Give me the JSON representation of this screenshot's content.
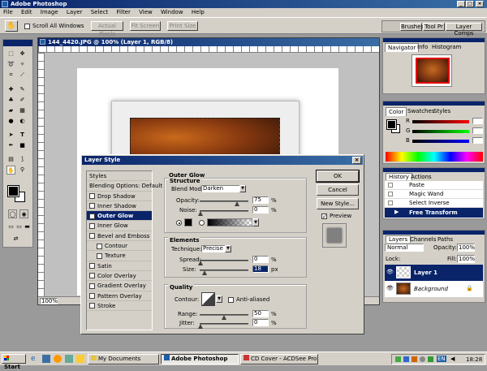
{
  "app": {
    "title": "Adobe Photoshop"
  },
  "menu": [
    "File",
    "Edit",
    "Image",
    "Layer",
    "Select",
    "Filter",
    "View",
    "Window",
    "Help"
  ],
  "options_bar": {
    "scroll_all": "Scroll All Windows",
    "actual_pixels": "Actual Pixels",
    "fit_screen": "Fit Screen",
    "print_size": "Print Size"
  },
  "well_tabs": [
    "Brushes",
    "Tool Pr",
    "Layer Comps"
  ],
  "document": {
    "title": "144_4420.JPG @ 100% (Layer 1, RGB/8)",
    "zoom": "100%"
  },
  "navigator": {
    "tabs": [
      "Navigator",
      "Info",
      "Histogram"
    ]
  },
  "color_panel": {
    "tabs": [
      "Color",
      "Swatches",
      "Styles"
    ],
    "channels": [
      "R",
      "G",
      "B"
    ]
  },
  "history": {
    "tabs": [
      "History",
      "Actions"
    ],
    "items": [
      "Paste",
      "Magic Wand",
      "Select Inverse",
      "Free Transform"
    ]
  },
  "layers": {
    "tabs": [
      "Layers",
      "Channels",
      "Paths"
    ],
    "blend_mode": "Normal",
    "opacity_label": "Opacity:",
    "opacity": "100%",
    "lock_label": "Lock:",
    "fill_label": "Fill:",
    "fill": "100%",
    "items": [
      {
        "name": "Layer 1"
      },
      {
        "name": "Background"
      }
    ]
  },
  "dialog": {
    "title": "Layer Style",
    "styles_header": "Styles",
    "blending_options": "Blending Options: Default",
    "effects": [
      {
        "label": "Drop Shadow",
        "checked": false,
        "indent": false
      },
      {
        "label": "Inner Shadow",
        "checked": false,
        "indent": false
      },
      {
        "label": "Outer Glow",
        "checked": true,
        "indent": false
      },
      {
        "label": "Inner Glow",
        "checked": false,
        "indent": false
      },
      {
        "label": "Bevel and Emboss",
        "checked": false,
        "indent": false
      },
      {
        "label": "Contour",
        "checked": false,
        "indent": true
      },
      {
        "label": "Texture",
        "checked": false,
        "indent": true
      },
      {
        "label": "Satin",
        "checked": false,
        "indent": false
      },
      {
        "label": "Color Overlay",
        "checked": false,
        "indent": false
      },
      {
        "label": "Gradient Overlay",
        "checked": false,
        "indent": false
      },
      {
        "label": "Pattern Overlay",
        "checked": false,
        "indent": false
      },
      {
        "label": "Stroke",
        "checked": false,
        "indent": false
      }
    ],
    "section_title": "Outer Glow",
    "structure": {
      "title": "Structure",
      "blend_mode_label": "Blend Mode:",
      "blend_mode": "Darken",
      "opacity_label": "Opacity:",
      "opacity": "75",
      "opacity_unit": "%",
      "noise_label": "Noise:",
      "noise": "0",
      "noise_unit": "%"
    },
    "elements": {
      "title": "Elements",
      "technique_label": "Technique:",
      "technique": "Precise",
      "spread_label": "Spread:",
      "spread": "0",
      "spread_unit": "%",
      "size_label": "Size:",
      "size": "18",
      "size_unit": "px"
    },
    "quality": {
      "title": "Quality",
      "contour_label": "Contour:",
      "anti_aliased": "Anti-aliased",
      "range_label": "Range:",
      "range": "50",
      "range_unit": "%",
      "jitter_label": "Jitter:",
      "jitter": "0",
      "jitter_unit": "%"
    },
    "buttons": {
      "ok": "OK",
      "cancel": "Cancel",
      "new_style": "New Style...",
      "preview": "Preview"
    }
  },
  "taskbar": {
    "start": "Start",
    "tasks": [
      "My Documents",
      "Adobe Photoshop",
      "CD Cover - ACDSee Pro P..."
    ],
    "tray_lang": "EN",
    "clock": "18:28"
  },
  "colors": {
    "titlebar": "#0a246a",
    "selection": "#0a246a",
    "face": "#d4d0c8"
  }
}
